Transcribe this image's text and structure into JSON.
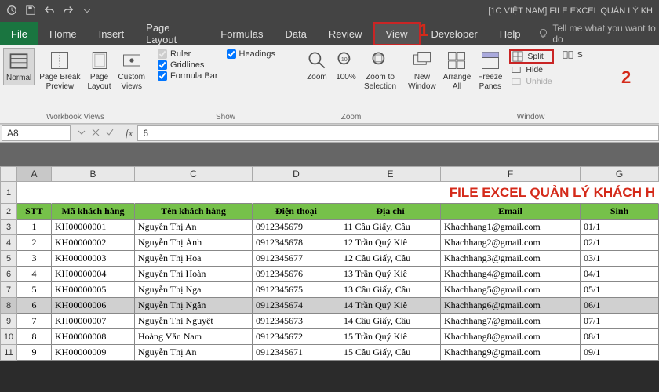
{
  "titlebar": {
    "title": "[1C VIỆT NAM] FILE EXCEL QUẢN LÝ KH"
  },
  "menu": {
    "file": "File",
    "home": "Home",
    "insert": "Insert",
    "page_layout": "Page Layout",
    "formulas": "Formulas",
    "data": "Data",
    "review": "Review",
    "view": "View",
    "developer": "Developer",
    "help": "Help",
    "tellme": "Tell me what you want to do"
  },
  "annot": {
    "one": "1",
    "two": "2"
  },
  "ribbon": {
    "views": {
      "normal": "Normal",
      "page_break": "Page Break\nPreview",
      "page_layout": "Page\nLayout",
      "custom": "Custom\nViews",
      "group": "Workbook Views"
    },
    "show": {
      "ruler": "Ruler",
      "gridlines": "Gridlines",
      "formula_bar": "Formula Bar",
      "headings": "Headings",
      "group": "Show"
    },
    "zoom": {
      "zoom": "Zoom",
      "hundred": "100%",
      "zts": "Zoom to\nSelection",
      "group": "Zoom"
    },
    "window": {
      "new": "New\nWindow",
      "arrange": "Arrange\nAll",
      "freeze": "Freeze\nPanes",
      "split": "Split",
      "hide": "Hide",
      "unhide": "Unhide",
      "group": "Window"
    }
  },
  "namebox": {
    "ref": "A8",
    "fx": "fx",
    "val": "6"
  },
  "cols": {
    "A": "A",
    "B": "B",
    "C": "C",
    "D": "D",
    "E": "E",
    "F": "F",
    "G": "G"
  },
  "title_text": "FILE EXCEL QUẢN LÝ KHÁCH H",
  "headers": {
    "stt": "STT",
    "ma": "Mã khách hàng",
    "ten": "Tên khách hàng",
    "dt": "Điện thoại",
    "dc": "Địa chỉ",
    "email": "Email",
    "sinh": "Sinh"
  },
  "rows": [
    {
      "r": "3",
      "stt": "1",
      "ma": "KH00000001",
      "ten": "Nguyễn Thị An",
      "dt": "0912345679",
      "dc": "11 Cầu Giấy, Cầu",
      "email": "Khachhang1@gmail.com",
      "sinh": "01/1"
    },
    {
      "r": "4",
      "stt": "2",
      "ma": "KH00000002",
      "ten": "Nguyễn Thị Ánh",
      "dt": "0912345678",
      "dc": "12 Trần Quý Kiê",
      "email": "Khachhang2@gmail.com",
      "sinh": "02/1"
    },
    {
      "r": "5",
      "stt": "3",
      "ma": "KH00000003",
      "ten": "Nguyễn Thị Hoa",
      "dt": "0912345677",
      "dc": "12 Cầu Giấy, Cầu",
      "email": "Khachhang3@gmail.com",
      "sinh": "03/1"
    },
    {
      "r": "6",
      "stt": "4",
      "ma": "KH00000004",
      "ten": "Nguyễn Thị Hoàn",
      "dt": "0912345676",
      "dc": "13 Trần Quý Kiê",
      "email": "Khachhang4@gmail.com",
      "sinh": "04/1"
    },
    {
      "r": "7",
      "stt": "5",
      "ma": "KH00000005",
      "ten": "Nguyễn Thị Nga",
      "dt": "0912345675",
      "dc": "13 Cầu Giấy, Cầu",
      "email": "Khachhang5@gmail.com",
      "sinh": "05/1"
    },
    {
      "r": "8",
      "stt": "6",
      "ma": "KH00000006",
      "ten": "Nguyễn Thị Ngân",
      "dt": "0912345674",
      "dc": "14 Trần Quý Kiê",
      "email": "Khachhang6@gmail.com",
      "sinh": "06/1"
    },
    {
      "r": "9",
      "stt": "7",
      "ma": "KH00000007",
      "ten": "Nguyễn Thị Nguyệt",
      "dt": "0912345673",
      "dc": "14 Cầu Giấy, Cầu",
      "email": "Khachhang7@gmail.com",
      "sinh": "07/1"
    },
    {
      "r": "10",
      "stt": "8",
      "ma": "KH00000008",
      "ten": "Hoàng Văn Nam",
      "dt": "0912345672",
      "dc": "15 Trần Quý Kiê",
      "email": "Khachhang8@gmail.com",
      "sinh": "08/1"
    },
    {
      "r": "11",
      "stt": "9",
      "ma": "KH00000009",
      "ten": "Nguyễn Thị An",
      "dt": "0912345671",
      "dc": "15 Cầu Giấy, Cầu",
      "email": "Khachhang9@gmail.com",
      "sinh": "09/1"
    }
  ]
}
